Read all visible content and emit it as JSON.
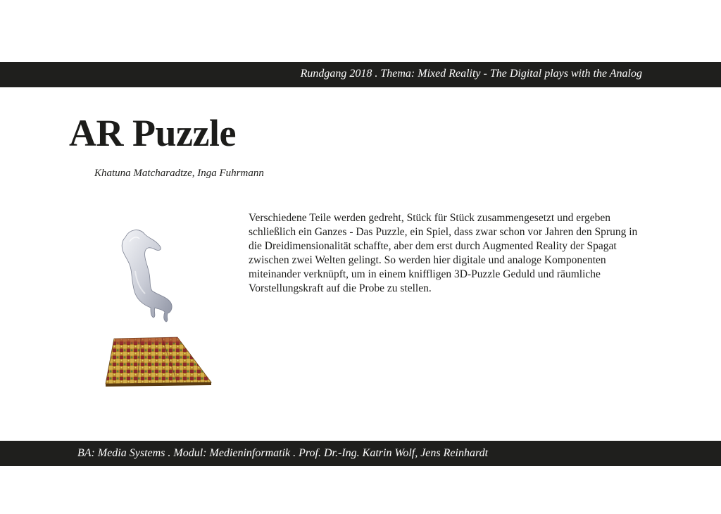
{
  "header": {
    "text": "Rundgang 2018 . Thema: Mixed Reality - The Digital plays with the Analog"
  },
  "project": {
    "title": "AR Puzzle",
    "authors": "Khatuna Matcharadtze, Inga Fuhrmann",
    "description": "Verschiedene Teile werden gedreht, Stück für Stück zusammengesetzt und ergeben schließlich ein Ganzes - Das Puzzle, ein Spiel, dass zwar schon vor Jahren den Sprung in die Dreidimensionalität schaffte, aber dem erst durch Augmented Reality der Spagat zwischen zwei Welten gelingt. So werden hier digitale und analoge Komponenten miteinander verknüpft, um in einem kniffligen 3D-Puzzle Geduld und räumliche Vorstellungskraft  auf die Probe zu stellen."
  },
  "footer": {
    "text": "BA: Media Systems . Modul: Medieninformatik . Prof. Dr.-Ing. Katrin Wolf, Jens Reinhardt"
  },
  "colors": {
    "bar": "#1f1f1d",
    "bar_text": "#ffffff",
    "text": "#1c1c1a"
  }
}
